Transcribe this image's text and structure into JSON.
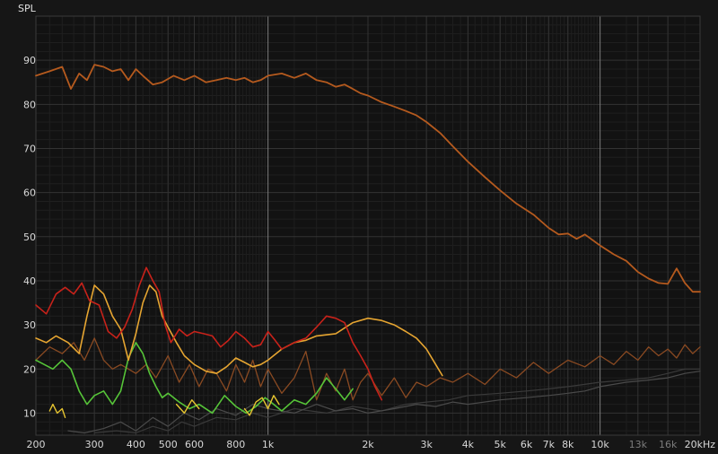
{
  "chart_data": {
    "type": "line",
    "ylabel": "SPL",
    "x_scale": "log",
    "xlim": [
      200,
      20000
    ],
    "ylim": [
      5,
      100
    ],
    "grid": true,
    "x_ticks": [
      {
        "v": 200,
        "label": "200"
      },
      {
        "v": 300,
        "label": "300"
      },
      {
        "v": 400,
        "label": "400"
      },
      {
        "v": 500,
        "label": "500"
      },
      {
        "v": 600,
        "label": "600"
      },
      {
        "v": 800,
        "label": "800"
      },
      {
        "v": 1000,
        "label": "1k"
      },
      {
        "v": 2000,
        "label": "2k"
      },
      {
        "v": 3000,
        "label": "3k"
      },
      {
        "v": 4000,
        "label": "4k"
      },
      {
        "v": 5000,
        "label": "5k"
      },
      {
        "v": 6000,
        "label": "6k"
      },
      {
        "v": 7000,
        "label": "7k"
      },
      {
        "v": 8000,
        "label": "8k"
      },
      {
        "v": 10000,
        "label": "10k"
      },
      {
        "v": 13000,
        "label": "13k",
        "dim": true
      },
      {
        "v": 16000,
        "label": "16k",
        "dim": true
      },
      {
        "v": 20000,
        "label": "20kHz"
      }
    ],
    "y_ticks": [
      {
        "v": 10,
        "label": "10"
      },
      {
        "v": 20,
        "label": "20"
      },
      {
        "v": 30,
        "label": "30"
      },
      {
        "v": 40,
        "label": "40"
      },
      {
        "v": 50,
        "label": "50"
      },
      {
        "v": 60,
        "label": "60"
      },
      {
        "v": 70,
        "label": "70"
      },
      {
        "v": 80,
        "label": "80"
      },
      {
        "v": 90,
        "label": "90"
      }
    ],
    "series": [
      {
        "color": "#b55a1e",
        "width": 1.8,
        "x": [
          200,
          220,
          240,
          255,
          270,
          285,
          300,
          320,
          340,
          360,
          380,
          400,
          420,
          450,
          480,
          520,
          560,
          600,
          650,
          700,
          750,
          800,
          850,
          900,
          950,
          1000,
          1100,
          1200,
          1300,
          1400,
          1500,
          1600,
          1700,
          1800,
          1900,
          2000,
          2200,
          2400,
          2600,
          2800,
          3000,
          3300,
          3600,
          4000,
          4500,
          5000,
          5600,
          6300,
          7000,
          7500,
          8000,
          8500,
          9000,
          10000,
          11000,
          12000,
          13000,
          14000,
          15000,
          16000,
          17000,
          18000,
          19000,
          20000
        ],
        "y": [
          86.5,
          87.5,
          88.5,
          83.5,
          87,
          85.5,
          89,
          88.5,
          87.5,
          88,
          85.5,
          88,
          86.5,
          84.5,
          85,
          86.5,
          85.5,
          86.5,
          85,
          85.5,
          86,
          85.5,
          86,
          85,
          85.5,
          86.5,
          87,
          86,
          87,
          85.5,
          85,
          84,
          84.5,
          83.5,
          82.5,
          82,
          80.5,
          79.5,
          78.5,
          77.5,
          76,
          73.5,
          70.5,
          67,
          63.5,
          60.5,
          57.5,
          55,
          52,
          50.5,
          50.7,
          49.5,
          50.5,
          48,
          46,
          44.5,
          42,
          40.5,
          39.5,
          39.3,
          42.8,
          39.5,
          37.5,
          37.5
        ]
      },
      {
        "color": "#c8221a",
        "width": 1.6,
        "x": [
          200,
          215,
          230,
          245,
          260,
          275,
          290,
          310,
          330,
          350,
          370,
          390,
          410,
          430,
          450,
          470,
          490,
          510,
          540,
          570,
          600,
          640,
          680,
          720,
          760,
          800,
          850,
          900,
          950,
          1000,
          1050,
          1100,
          1200,
          1300,
          1400,
          1500,
          1600,
          1700,
          1800,
          1900,
          2000,
          2100,
          2200
        ],
        "y": [
          34.5,
          32.5,
          37,
          38.5,
          37,
          39.5,
          35.5,
          34.5,
          28.5,
          27,
          29.5,
          33.5,
          39,
          43,
          40,
          37.5,
          30,
          26,
          29,
          27.5,
          28.5,
          28,
          27.5,
          25,
          26.5,
          28.5,
          27,
          25,
          25.5,
          28.5,
          26.5,
          24.5,
          26,
          27,
          29.5,
          32,
          31.5,
          30.5,
          26,
          23,
          20,
          16,
          13
        ]
      },
      {
        "color": "#e6a531",
        "width": 1.6,
        "x": [
          200,
          215,
          230,
          250,
          270,
          285,
          300,
          320,
          340,
          360,
          380,
          400,
          420,
          440,
          460,
          480,
          500,
          530,
          560,
          600,
          650,
          700,
          750,
          800,
          850,
          900,
          950,
          1000,
          1100,
          1200,
          1300,
          1400,
          1600,
          1800,
          2000,
          2200,
          2400,
          2600,
          2800,
          3000,
          3200,
          3350
        ],
        "y": [
          27,
          26,
          27.5,
          26,
          23.5,
          32,
          39,
          37,
          32,
          29,
          22,
          28,
          35,
          39,
          37.5,
          32,
          29.5,
          26,
          23,
          21,
          19.5,
          19,
          20.5,
          22.5,
          21.5,
          20.5,
          21,
          22,
          24.5,
          26,
          26.5,
          27.5,
          28,
          30.5,
          31.5,
          31,
          30,
          28.5,
          27,
          24.5,
          21,
          18.5
        ]
      },
      {
        "color": "#e6c530",
        "width": 1.4,
        "x": [
          220,
          225,
          232,
          240,
          245
        ],
        "y": [
          10.5,
          12,
          10,
          11,
          9
        ]
      },
      {
        "color": "#e6c530",
        "width": 1.4,
        "x": [
          530,
          560,
          590,
          620
        ],
        "y": [
          12,
          10,
          13,
          11
        ]
      },
      {
        "color": "#e6c530",
        "width": 1.4,
        "x": [
          850,
          880,
          920,
          960,
          1000,
          1040,
          1080
        ],
        "y": [
          11,
          9.5,
          12.5,
          13.5,
          11,
          14,
          12
        ]
      },
      {
        "color": "#56c438",
        "width": 1.6,
        "x": [
          200,
          212,
          225,
          240,
          255,
          270,
          285,
          300,
          320,
          340,
          360,
          380,
          400,
          420,
          440,
          460,
          480,
          500,
          540,
          580,
          620,
          680,
          740,
          800,
          860,
          920,
          980,
          1040,
          1100,
          1200,
          1300,
          1400,
          1500,
          1600,
          1700,
          1800
        ],
        "y": [
          22,
          21,
          20,
          22,
          20,
          15,
          12,
          14,
          15,
          12,
          15,
          22.5,
          26,
          23.5,
          19,
          16,
          13.5,
          14.5,
          12.5,
          11,
          12,
          10,
          14,
          11.5,
          10,
          11.5,
          13.5,
          12,
          10.5,
          13,
          12,
          14.5,
          18,
          15.5,
          13,
          15.5
        ]
      },
      {
        "color": "#8a4a22",
        "width": 1.3,
        "x": [
          200,
          220,
          240,
          260,
          280,
          300,
          320,
          340,
          360,
          380,
          400,
          430,
          460,
          500,
          540,
          580,
          620,
          660,
          700,
          750,
          800,
          850,
          900,
          950,
          1000,
          1100,
          1200,
          1300,
          1400,
          1500,
          1600,
          1700,
          1800,
          1900,
          2000,
          2200,
          2400,
          2600,
          2800,
          3000,
          3300,
          3600,
          4000,
          4500,
          5000,
          5600,
          6300,
          7000,
          8000,
          9000,
          10000,
          11000,
          12000,
          13000,
          14000,
          15000,
          16000,
          17000,
          18000,
          19000,
          20000
        ],
        "y": [
          22,
          25,
          23.5,
          26,
          22,
          27,
          22,
          20,
          21,
          20,
          19,
          21,
          18,
          23,
          17,
          21,
          16,
          20,
          19,
          15,
          21,
          17,
          22,
          16,
          20,
          14.5,
          18,
          24,
          13,
          19,
          15,
          20,
          13,
          17,
          19,
          14,
          18,
          13.5,
          17,
          16,
          18,
          17,
          19,
          16.5,
          20,
          18,
          21.5,
          19,
          22,
          20.5,
          23,
          21,
          24,
          22,
          25,
          23,
          24.5,
          22.5,
          25.5,
          23.5,
          25
        ]
      },
      {
        "color": "#4a4a4a",
        "width": 1.2,
        "x": [
          250,
          280,
          320,
          360,
          400,
          450,
          500,
          560,
          620,
          700,
          800,
          900,
          1000,
          1200,
          1400,
          1600,
          1800,
          2000,
          2400,
          2800,
          3200,
          3600,
          4000,
          5000,
          6000,
          7000,
          8000,
          9000,
          10000,
          12000,
          14000,
          16000,
          18000,
          20000
        ],
        "y": [
          6,
          5.5,
          6.5,
          8,
          6,
          9,
          7,
          10,
          8.5,
          11,
          9.5,
          12,
          11,
          10,
          12,
          10.5,
          11,
          10,
          11,
          12,
          11.5,
          12.5,
          12,
          13,
          13.5,
          14,
          14.5,
          15,
          16,
          17,
          17.5,
          18,
          19,
          19.5
        ]
      },
      {
        "color": "#3a3a3a",
        "width": 1.2,
        "x": [
          300,
          350,
          400,
          450,
          500,
          550,
          600,
          700,
          800,
          900,
          1000,
          1200,
          1500,
          1800,
          2200,
          2600,
          3000,
          3500,
          4000,
          5000,
          6000,
          7000,
          8000,
          10000,
          12000,
          14000,
          16000,
          18000,
          20000
        ],
        "y": [
          5.5,
          6,
          5.5,
          7,
          6,
          8,
          7,
          9,
          8.5,
          10,
          9,
          11,
          10,
          11.5,
          10.5,
          12,
          12.5,
          13,
          14,
          14.5,
          15,
          15.5,
          16,
          17,
          17.5,
          18,
          19,
          20,
          20
        ]
      }
    ]
  }
}
